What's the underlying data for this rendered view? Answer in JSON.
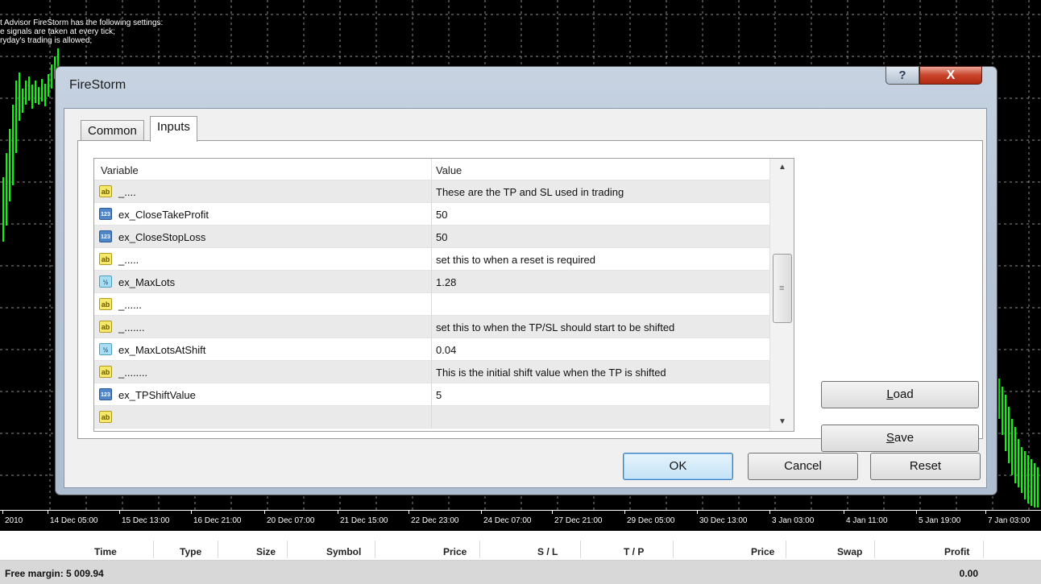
{
  "chart": {
    "comment_lines": [
      "t Advisor FireStorm has the following settings:",
      "e signals are taken at every tick;",
      "ryday's trading is allowed;"
    ],
    "time_labels": [
      "2010",
      "14 Dec 05:00",
      "15 Dec 13:00",
      "16 Dec 21:00",
      "20 Dec 07:00",
      "21 Dec 15:00",
      "22 Dec 23:00",
      "24 Dec 07:00",
      "27 Dec 21:00",
      "29 Dec 05:00",
      "30 Dec 13:00",
      "3 Jan 03:00",
      "4 Jan 11:00",
      "5 Jan 19:00",
      "7 Jan 03:00"
    ],
    "candle_color": "#00ff00",
    "grid_color": "#ffffff"
  },
  "dialog": {
    "title": "FireStorm",
    "help_button": "?",
    "close_button": "X",
    "tabs": [
      {
        "label": "Common",
        "active": false
      },
      {
        "label": "Inputs",
        "active": true
      }
    ],
    "grid": {
      "col_variable": "Variable",
      "col_value": "Value",
      "rows": [
        {
          "icon": "ab",
          "variable": "_....",
          "value": "These are the TP and SL used in trading"
        },
        {
          "icon": "123",
          "variable": "ex_CloseTakeProfit",
          "value": "50"
        },
        {
          "icon": "123",
          "variable": "ex_CloseStopLoss",
          "value": "50"
        },
        {
          "icon": "ab",
          "variable": "_.....",
          "value": "set this to when a reset is required"
        },
        {
          "icon": "v2",
          "variable": "ex_MaxLots",
          "value": "1.28"
        },
        {
          "icon": "ab",
          "variable": "_......",
          "value": ""
        },
        {
          "icon": "ab",
          "variable": "_.......",
          "value": "set this to when the TP/SL should start to be shifted"
        },
        {
          "icon": "v2",
          "variable": "ex_MaxLotsAtShift",
          "value": "0.04"
        },
        {
          "icon": "ab",
          "variable": "_........",
          "value": "This is the initial shift value when the TP is shifted"
        },
        {
          "icon": "123",
          "variable": "ex_TPShiftValue",
          "value": "5"
        },
        {
          "icon": "ab",
          "variable": "",
          "value": ""
        }
      ]
    },
    "buttons": {
      "load": {
        "first": "L",
        "rest": "oad"
      },
      "save": {
        "first": "S",
        "rest": "ave"
      },
      "ok": "OK",
      "cancel": "Cancel",
      "reset": "Reset"
    }
  },
  "terminal": {
    "columns": [
      "Time",
      "Type",
      "Size",
      "Symbol",
      "Price",
      "S / L",
      "T / P",
      "Price",
      "Swap",
      "Profit"
    ],
    "free_margin": "Free margin: 5 009.94",
    "profit_total": "0.00"
  }
}
